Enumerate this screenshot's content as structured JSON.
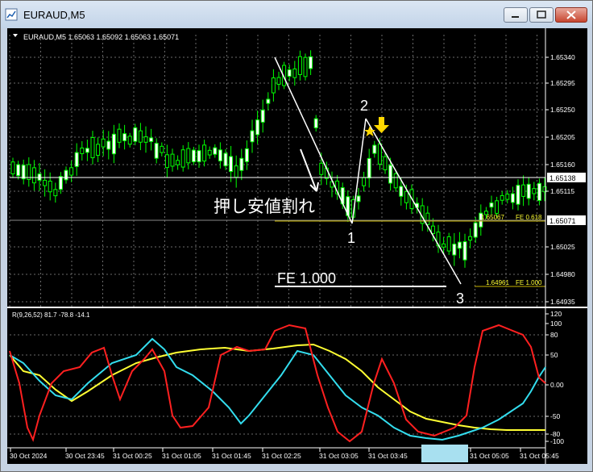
{
  "window": {
    "title": "EURAUD,M5",
    "minimize_label": "minimize",
    "maximize_label": "maximize",
    "close_label": "close"
  },
  "chart": {
    "header": "EURAUD,M5  1.65063 1.65092 1.65063 1.65071",
    "price_levels": [
      "1.65340",
      "1.65295",
      "1.65250",
      "1.65205",
      "1.65160",
      "1.65115",
      "1.65025",
      "1.64980",
      "1.64935"
    ],
    "bid_label": "1.65138",
    "current_price_label": "1.65071",
    "fib_levels": [
      {
        "price_text": "1.65067",
        "label": "FE 0.618"
      },
      {
        "price_text": "1.64961",
        "label": "FE 1.000"
      }
    ],
    "annotations": {
      "point1": "1",
      "point2": "2",
      "point3": "3",
      "break_text": "押し安値割れ",
      "fe_text": "FE 1.000"
    },
    "time_labels": [
      "30 Oct 2024",
      "30 Oct 23:45",
      "31 Oct 00:25",
      "31 Oct 01:05",
      "31 Oct 01:45",
      "31 Oct 02:25",
      "31 Oct 03:05",
      "31 Oct 03:45",
      "31 Oct 05:05",
      "31 Oct 05:45"
    ],
    "indicator": {
      "header": "R(9,26,52) 81.7 -78.8 -14.1",
      "levels": [
        "120",
        "100",
        "80",
        "50",
        "0.00",
        "-50",
        "-80",
        "-100"
      ]
    }
  },
  "colors": {
    "candle": "#00ff00",
    "rsi_fast": "#ff2020",
    "rsi_mid": "#33ddee",
    "rsi_slow": "#ffff33",
    "axis": "#ffffff",
    "highlight": "#a8e0f0"
  }
}
